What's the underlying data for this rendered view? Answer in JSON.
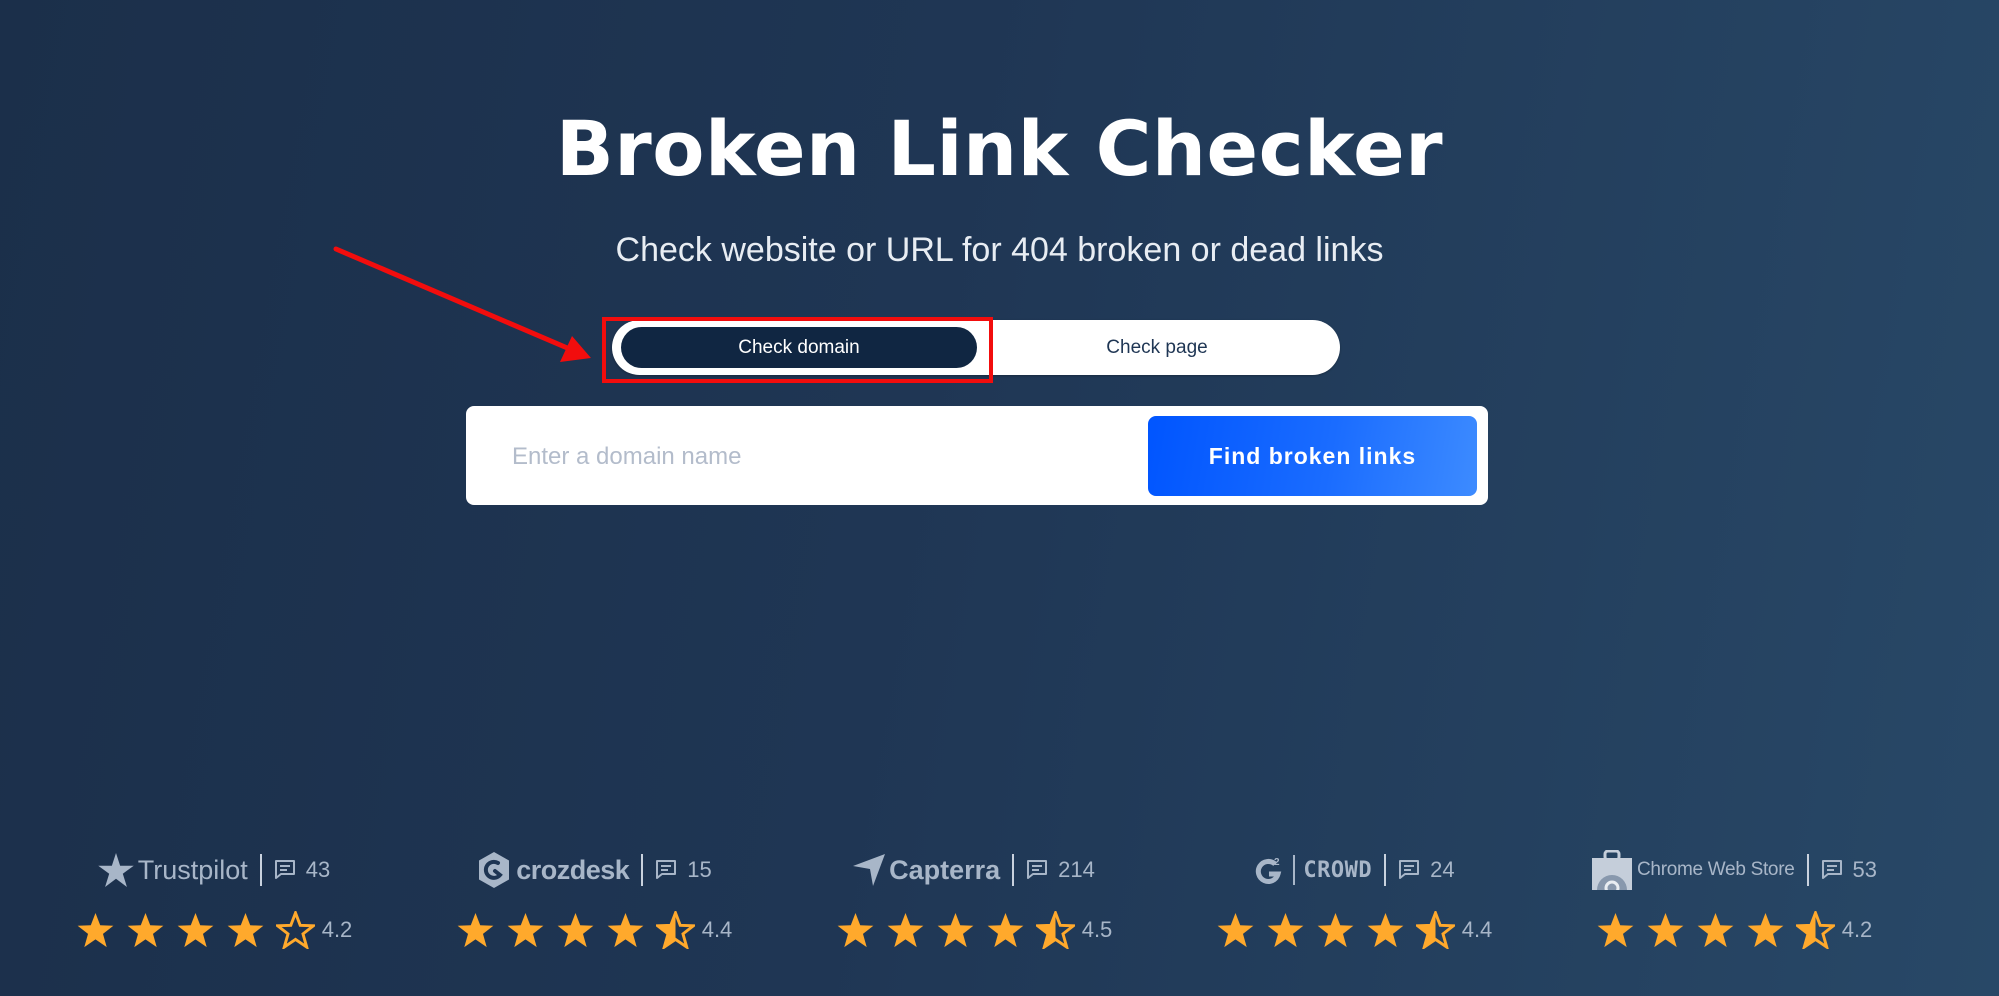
{
  "page": {
    "title": "Broken Link Checker",
    "subtitle": "Check website or URL for 404 broken or dead links"
  },
  "mode_toggle": {
    "options": [
      {
        "label": "Check domain",
        "active": true
      },
      {
        "label": "Check page",
        "active": false
      }
    ]
  },
  "search": {
    "placeholder": "Enter a domain name",
    "value": "",
    "button_label": "Find broken links"
  },
  "annotation": {
    "type": "red-arrow-and-box",
    "target": "Check domain",
    "color": "#f20d0d"
  },
  "colors": {
    "background_start": "#1b2f4a",
    "background_end": "#284867",
    "toggle_active": "#102642",
    "button_gradient_start": "#0055ff",
    "button_gradient_end": "#3d8bff",
    "star_fill": "#ffa92c",
    "muted_text": "#a8b6c8"
  },
  "ratings": [
    {
      "platform": "Trustpilot",
      "icon": "trustpilot-star-icon",
      "review_count": "43",
      "score": "4.2",
      "stars": [
        1,
        1,
        1,
        1,
        0
      ]
    },
    {
      "platform": "crozdesk",
      "icon": "crozdesk-logo-icon",
      "review_count": "15",
      "score": "4.4",
      "stars": [
        1,
        1,
        1,
        1,
        0.5
      ]
    },
    {
      "platform": "Capterra",
      "icon": "capterra-arrow-icon",
      "review_count": "214",
      "score": "4.5",
      "stars": [
        1,
        1,
        1,
        1,
        0.5
      ]
    },
    {
      "platform": "CROWD",
      "icon": "g2-logo-icon",
      "review_count": "24",
      "score": "4.4",
      "stars": [
        1,
        1,
        1,
        1,
        0.5
      ]
    },
    {
      "platform": "Chrome Web Store",
      "icon": "chrome-web-store-icon",
      "review_count": "53",
      "score": "4.2",
      "stars": [
        1,
        1,
        1,
        1,
        0.5
      ]
    }
  ]
}
